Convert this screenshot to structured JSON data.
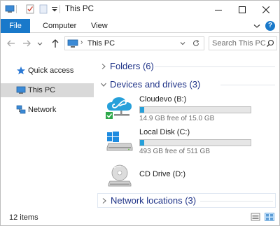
{
  "window": {
    "title": "This PC",
    "controls": {
      "minimize": "minimize",
      "maximize": "maximize",
      "close": "close"
    }
  },
  "ribbon": {
    "tabs": [
      {
        "label": "File",
        "active": true
      },
      {
        "label": "Computer"
      },
      {
        "label": "View"
      }
    ],
    "help_label": "?"
  },
  "navigation": {
    "address_crumb": "This PC",
    "search_placeholder": "Search This PC"
  },
  "sidebar": {
    "items": [
      {
        "label": "Quick access",
        "icon": "star-icon"
      },
      {
        "label": "This PC",
        "icon": "computer-icon",
        "selected": true
      },
      {
        "label": "Network",
        "icon": "network-icon"
      }
    ]
  },
  "content": {
    "groups": {
      "folders": "Folders (6)",
      "devices": "Devices and drives (3)",
      "network": "Network locations (3)"
    },
    "drives": [
      {
        "name": "Cloudevo (B:)",
        "free_text": "14.9 GB free of 15.0 GB",
        "used_fraction": 0.007,
        "icon": "cloud-drive-icon"
      },
      {
        "name": "Local Disk (C:)",
        "free_text": "493 GB free of 511 GB",
        "used_fraction": 0.035,
        "icon": "windows-disk-icon"
      },
      {
        "name": "CD Drive (D:)",
        "icon": "cd-drive-icon"
      }
    ]
  },
  "statusbar": {
    "item_count": "12 items"
  },
  "colors": {
    "accent": "#1979ca",
    "group_title": "#1e3287",
    "progress": "#26a0da",
    "selection": "#d9d9d9"
  }
}
